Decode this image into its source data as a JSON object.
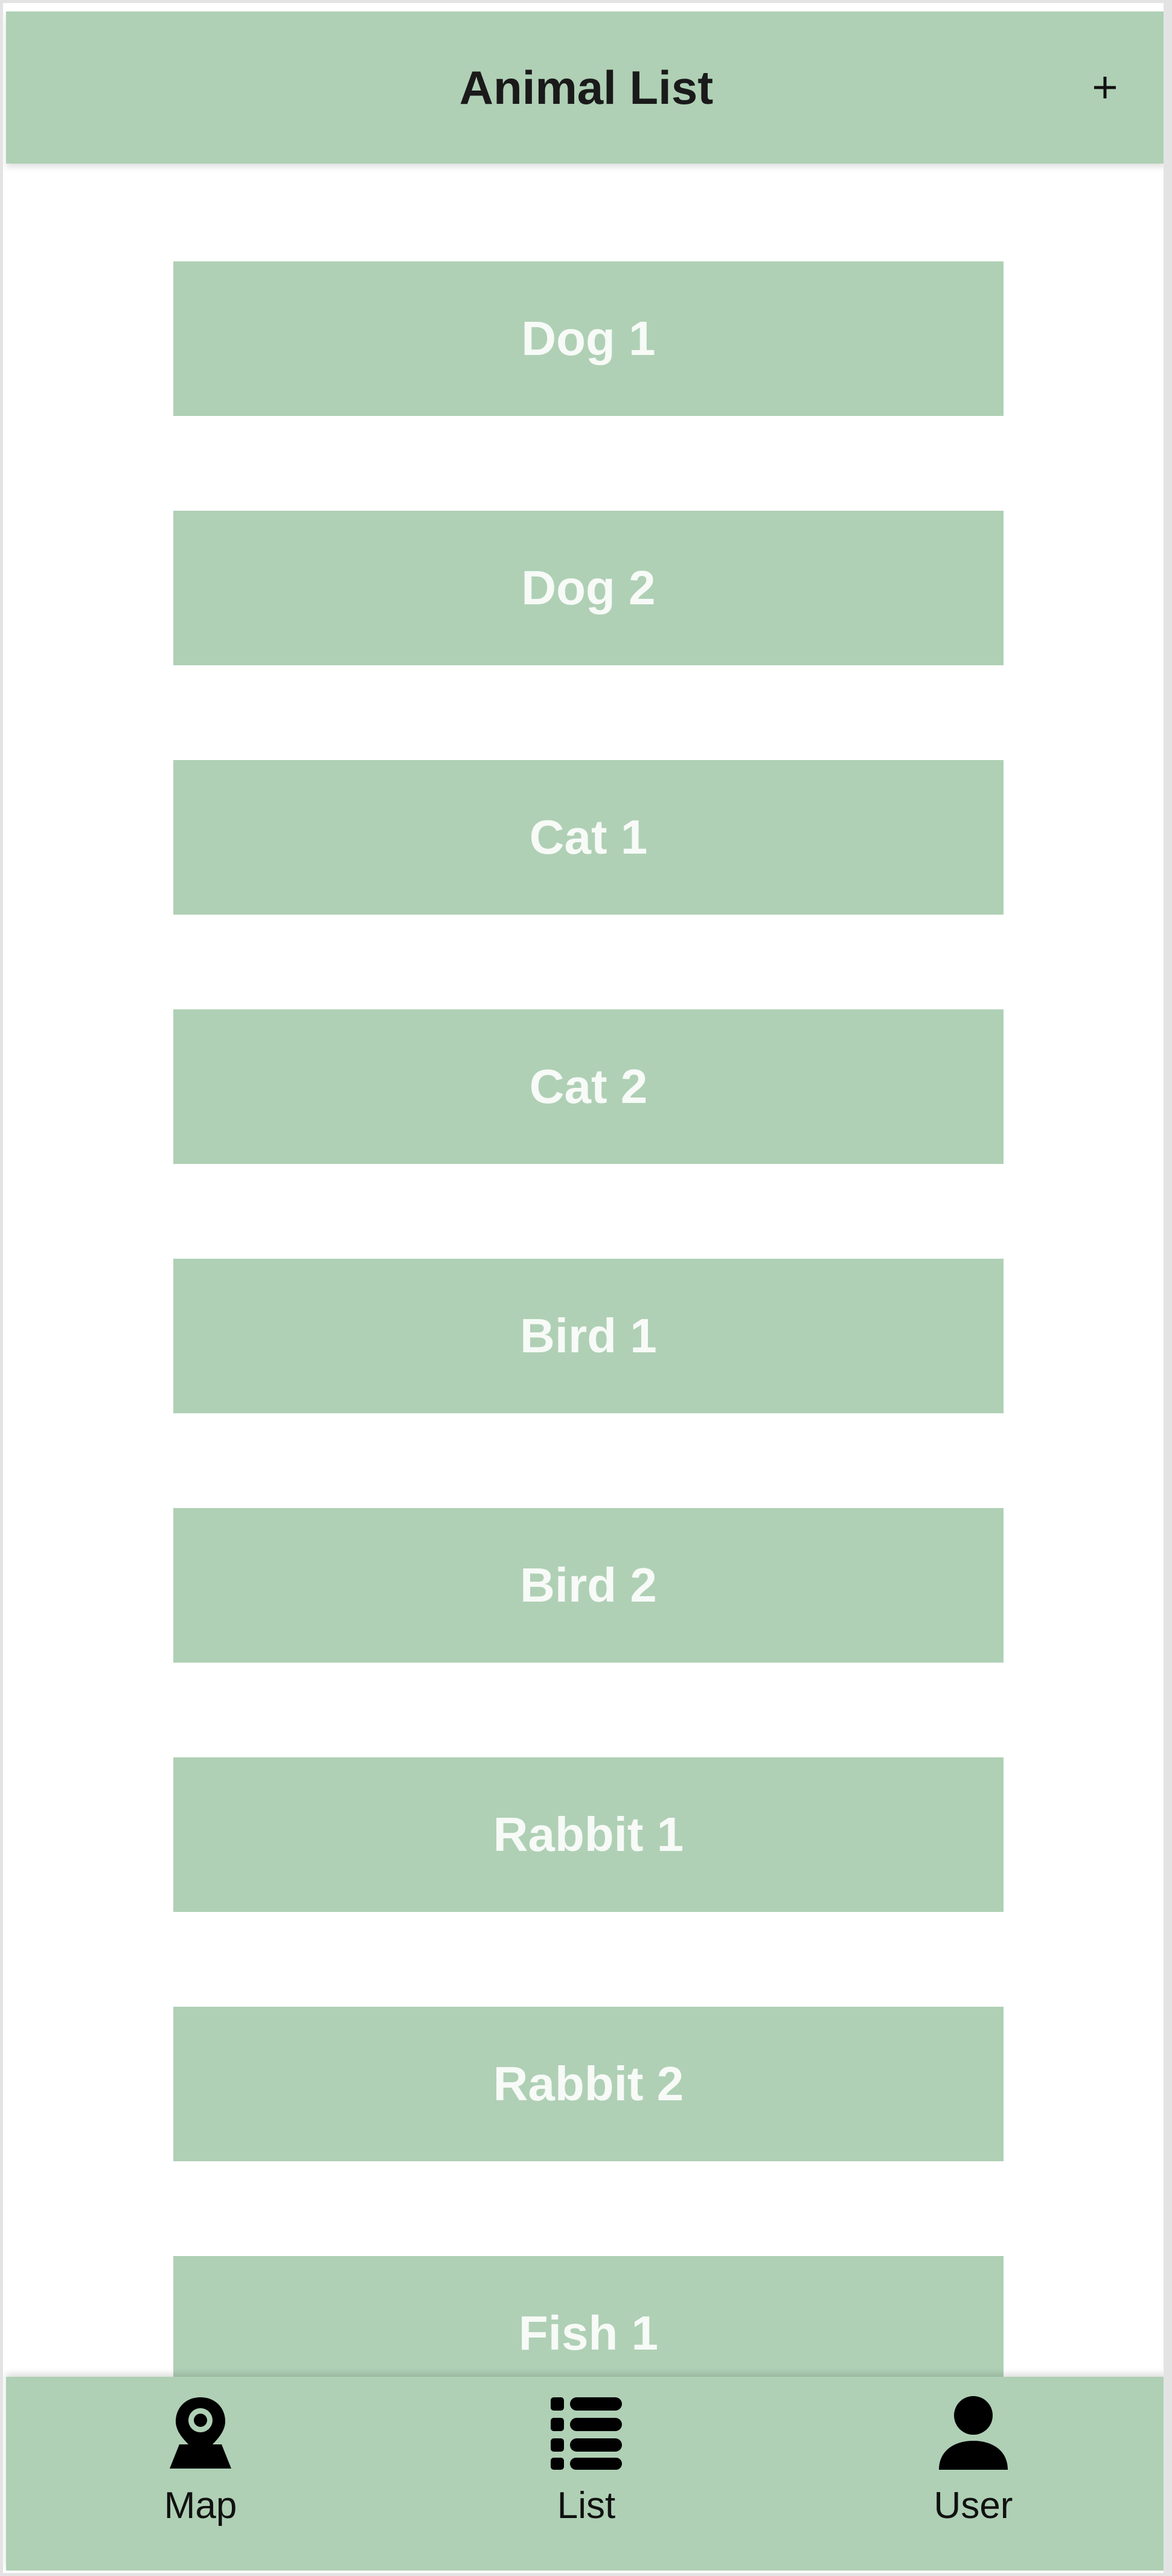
{
  "header": {
    "title": "Animal List",
    "add_icon": "plus-icon"
  },
  "animals": [
    {
      "label": "Dog 1"
    },
    {
      "label": "Dog 2"
    },
    {
      "label": "Cat 1"
    },
    {
      "label": "Cat 2"
    },
    {
      "label": "Bird 1"
    },
    {
      "label": "Bird 2"
    },
    {
      "label": "Rabbit 1"
    },
    {
      "label": "Rabbit 2"
    },
    {
      "label": "Fish 1"
    }
  ],
  "tabbar": {
    "tabs": [
      {
        "label": "Map",
        "icon": "map-pin-icon"
      },
      {
        "label": "List",
        "icon": "list-icon"
      },
      {
        "label": "User",
        "icon": "user-icon"
      }
    ]
  },
  "colors": {
    "accent": "#afd0b5",
    "item_text": "#f7faf7",
    "header_text": "#1a1a1a",
    "background": "#ffffff"
  }
}
